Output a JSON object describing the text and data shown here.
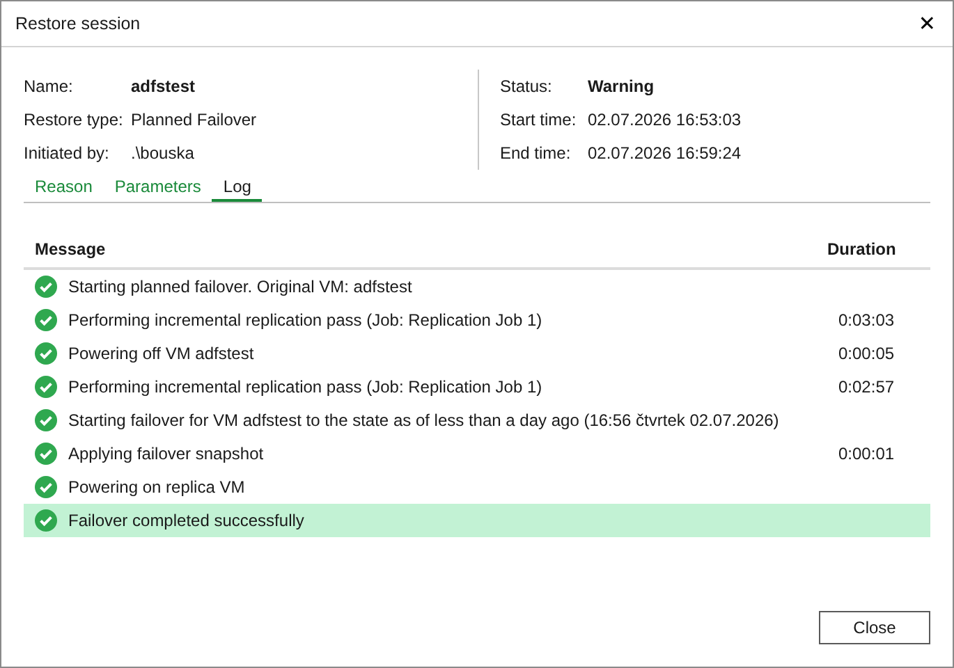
{
  "window": {
    "title": "Restore session",
    "close": "✕"
  },
  "details_left": [
    {
      "label": "Name:",
      "value": "adfstest",
      "bold": true
    },
    {
      "label": "Restore type:",
      "value": "Planned Failover",
      "bold": false
    },
    {
      "label": "Initiated by:",
      "value": ".\\bouska",
      "bold": false
    }
  ],
  "details_right": [
    {
      "label": "Status:",
      "value": "Warning",
      "bold": true
    },
    {
      "label": "Start time:",
      "value": "02.07.2026 16:53:03",
      "bold": false
    },
    {
      "label": "End time:",
      "value": "02.07.2026 16:59:24",
      "bold": false
    }
  ],
  "tabs": [
    {
      "label": "Reason",
      "selected": false
    },
    {
      "label": "Parameters",
      "selected": false
    },
    {
      "label": "Log",
      "selected": true
    }
  ],
  "table": {
    "columns": [
      "Message",
      "Duration"
    ],
    "rows": [
      {
        "kind": "success",
        "message": "Starting planned failover. Original VM: adfstest",
        "selected": false
      },
      {
        "kind": "success",
        "message": "Performing incremental replication pass (Job: Replication Job 1)",
        "duration": "0:03:03",
        "selected": false
      },
      {
        "kind": "success",
        "message": "Powering off VM adfstest",
        "duration": "0:00:05",
        "selected": false
      },
      {
        "kind": "success",
        "message": "Performing incremental replication pass (Job: Replication Job 1)",
        "duration": "0:02:57",
        "selected": false
      },
      {
        "kind": "success",
        "message": "Starting failover for VM adfstest to the state as of less than a day ago (16:56 čtvrtek 02.07.2026)",
        "selected": false
      },
      {
        "kind": "success",
        "message": "Applying failover snapshot",
        "duration": "0:00:01",
        "selected": false
      },
      {
        "kind": "success",
        "message": "Powering on replica VM",
        "selected": false
      },
      {
        "kind": "success",
        "message": "Failover completed successfully",
        "selected": true
      }
    ]
  },
  "buttons": [
    "Close"
  ]
}
